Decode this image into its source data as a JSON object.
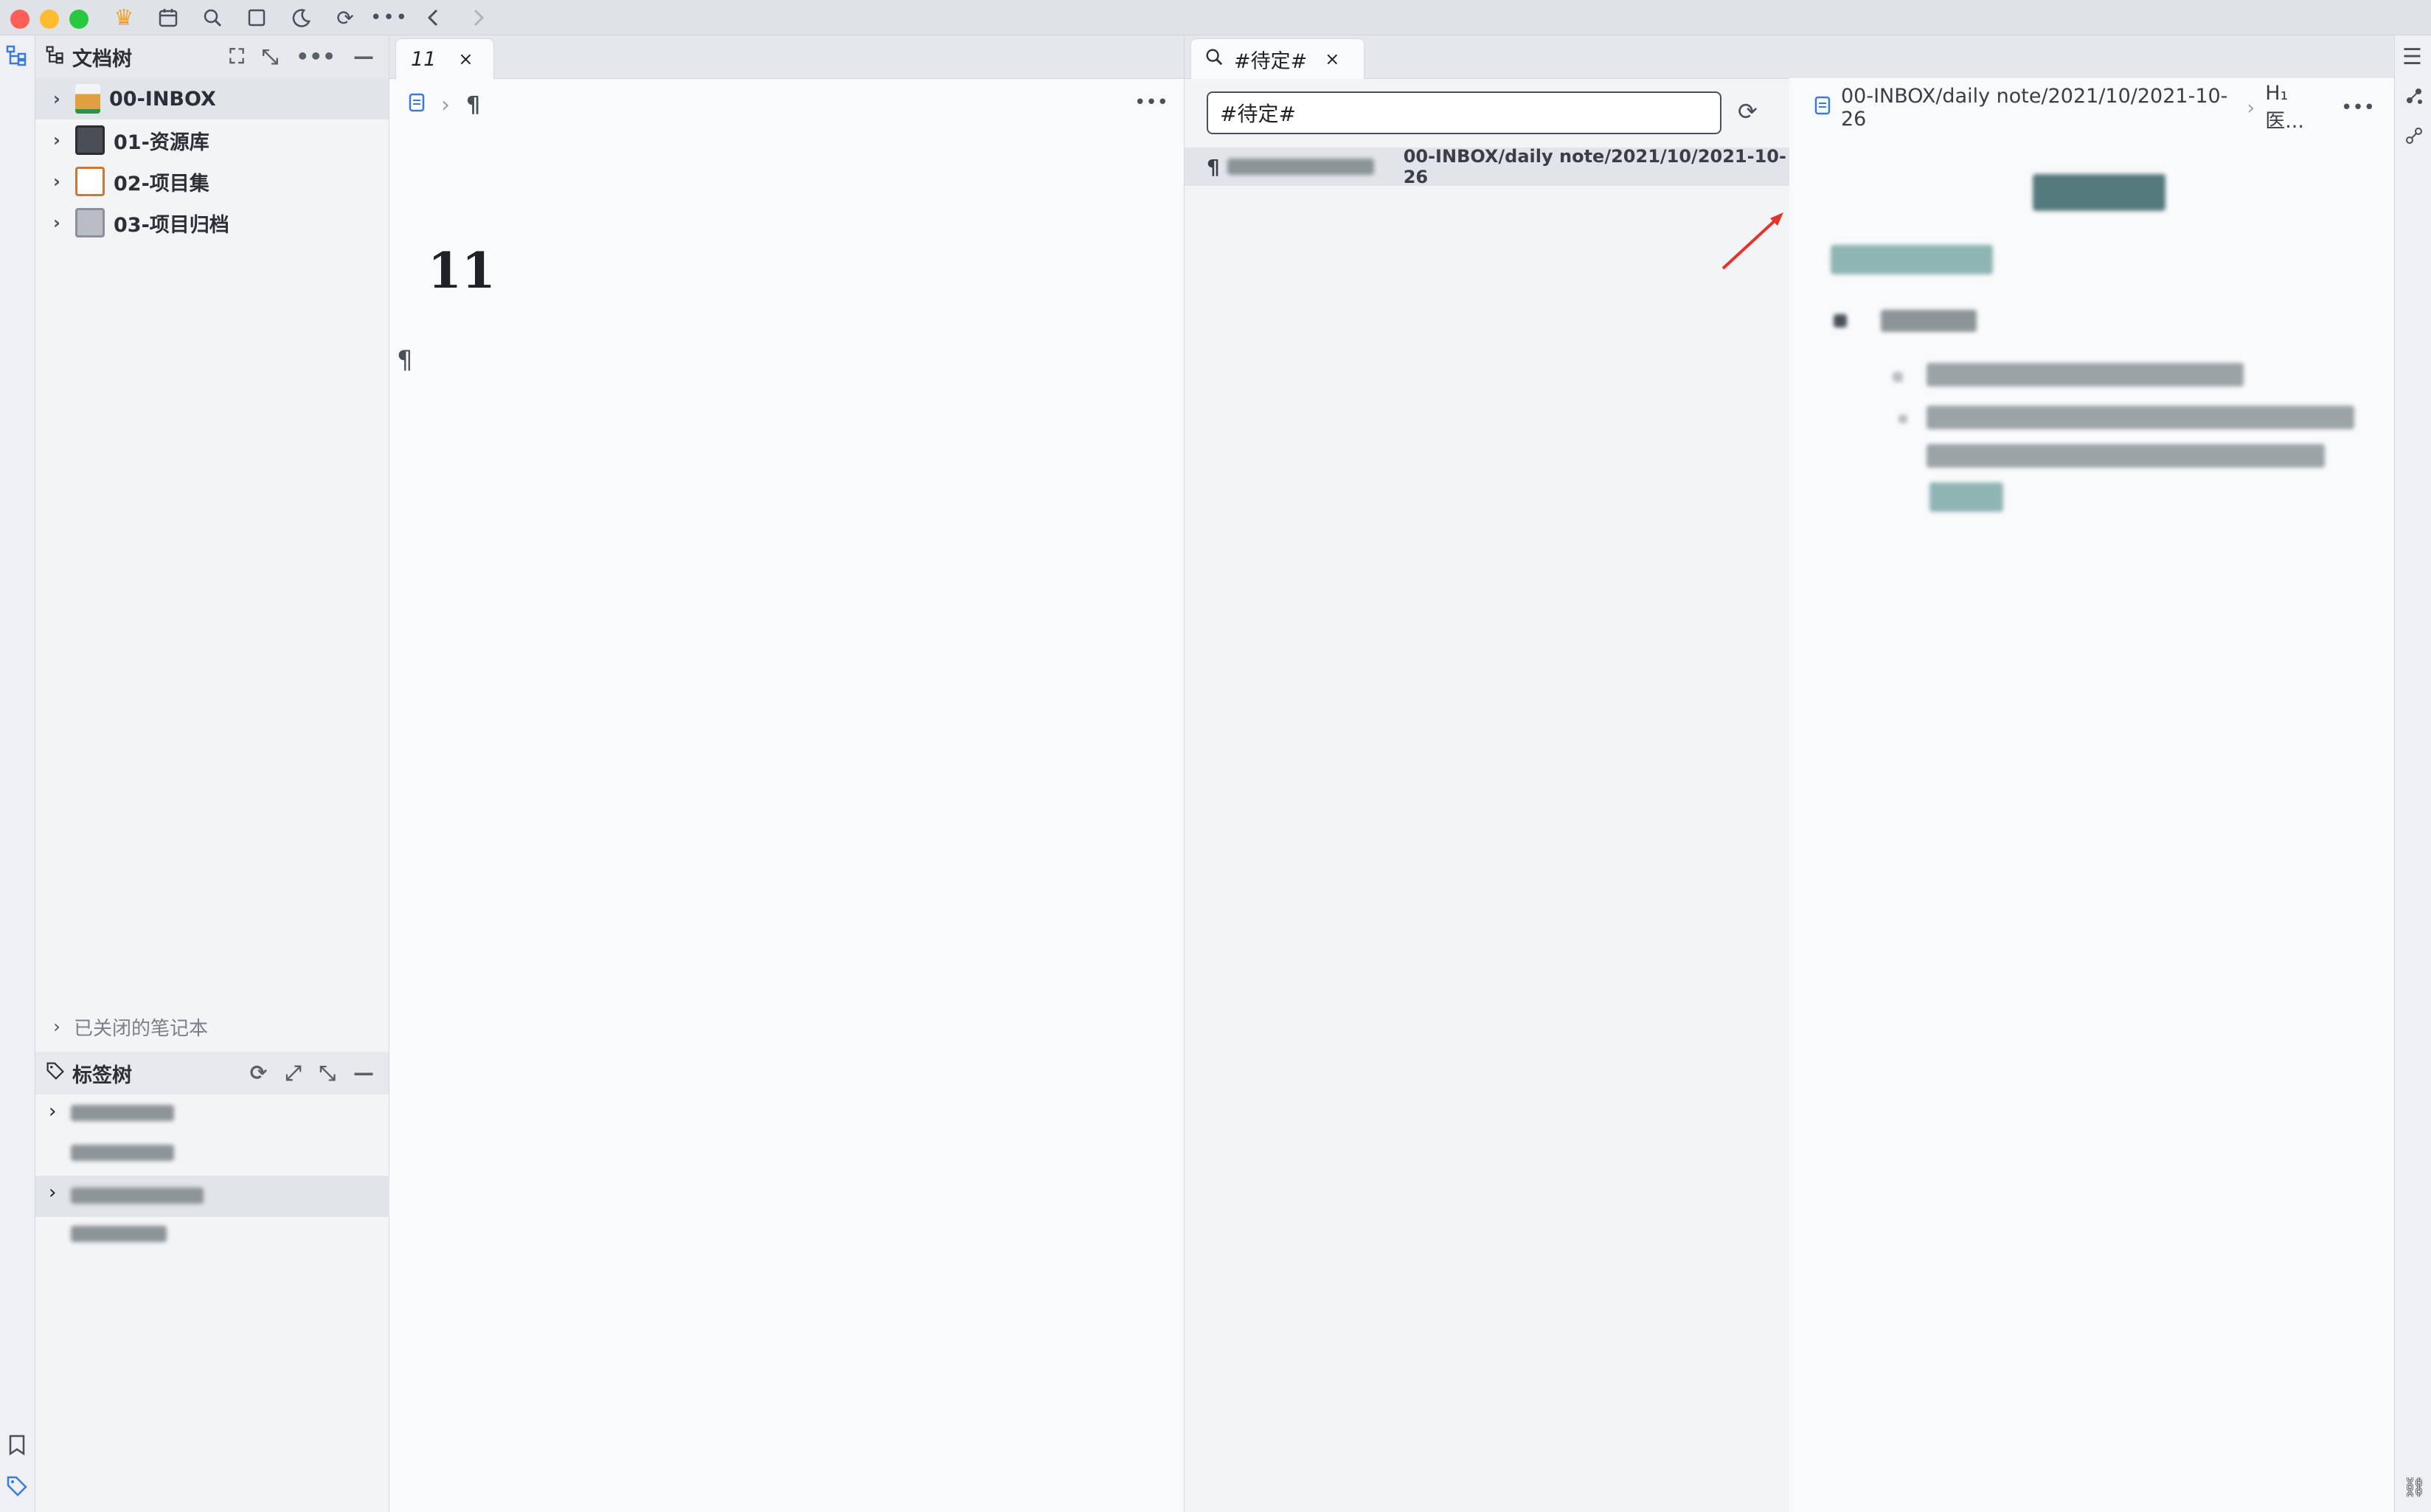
{
  "filetree": {
    "title": "文档树",
    "notebooks": [
      {
        "label": "00-INBOX"
      },
      {
        "label": "01-资源库"
      },
      {
        "label": "02-项目集"
      },
      {
        "label": "03-项目归档"
      }
    ],
    "closed_label": "已关闭的笔记本"
  },
  "tagtree": {
    "title": "标签树"
  },
  "editor": {
    "tab_label": "11",
    "pilcrow": "¶",
    "heading": "11"
  },
  "search": {
    "tab_label": "#待定#",
    "query": "#待定#",
    "result_path": "00-INBOX/daily note/2021/10/2021-10-26"
  },
  "preview": {
    "breadcrumb_path": "00-INBOX/daily note/2021/10/2021-10-26",
    "breadcrumb_heading": "H₁ 医..."
  },
  "colors": {
    "accent_red": "#e5322d",
    "traffic_red": "#ff5f57",
    "traffic_yellow": "#febc2e",
    "traffic_green": "#28c840",
    "blurred_text": "#8fa3a5"
  }
}
